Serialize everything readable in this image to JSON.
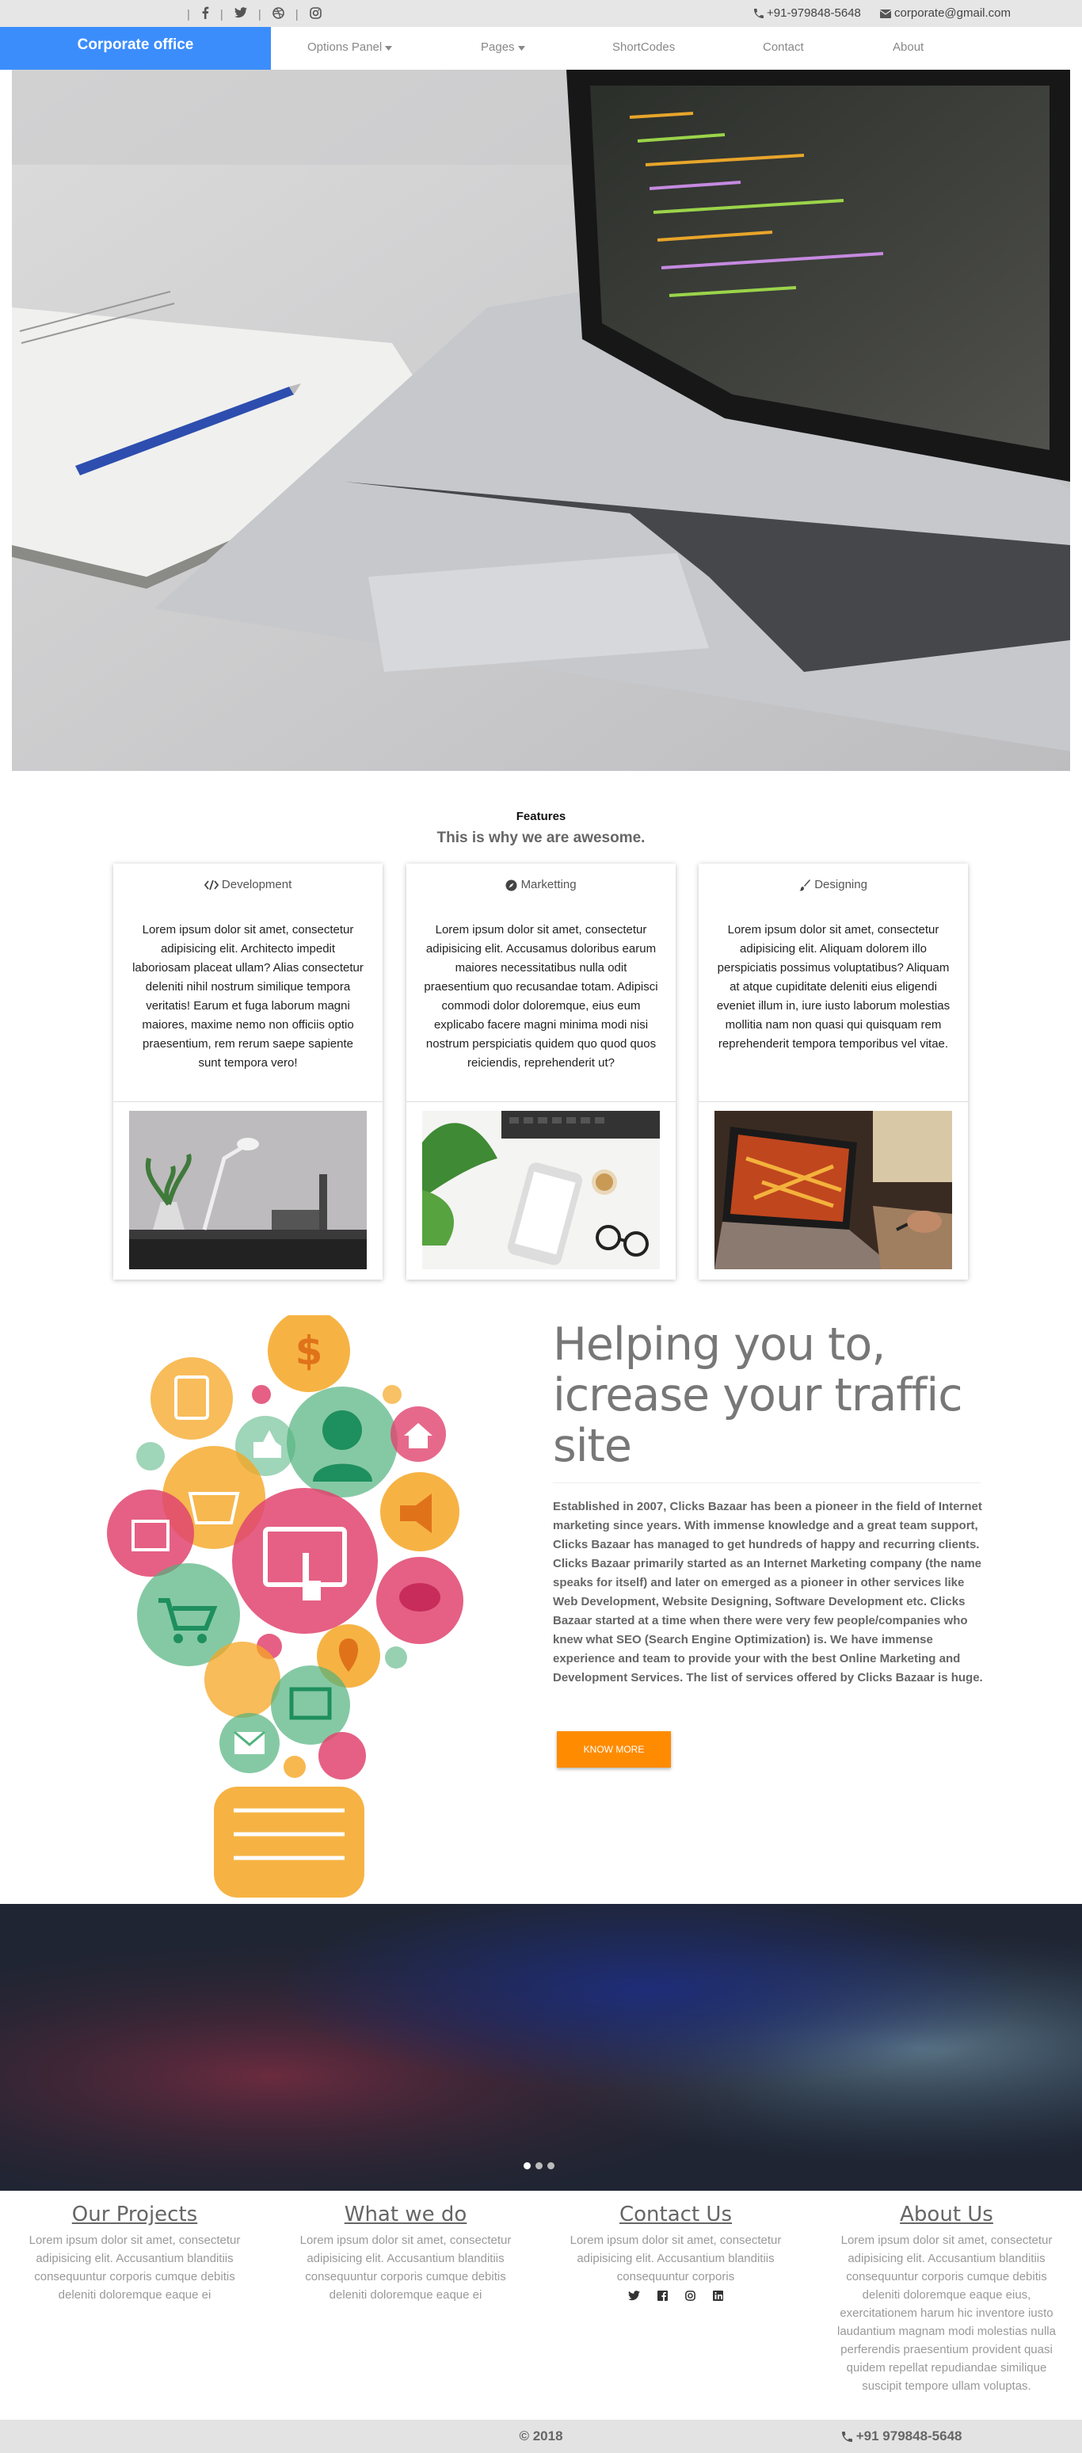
{
  "topbar": {
    "social_icons": [
      "facebook-icon",
      "twitter-icon",
      "dribbble-icon",
      "instagram-icon"
    ],
    "phone": "+91-979848-5648",
    "email": "corporate@gmail.com"
  },
  "nav": {
    "brand": "Corporate office",
    "items": [
      "Options Panel",
      "Pages",
      "ShortCodes",
      "Contact",
      "About"
    ]
  },
  "features": {
    "title": "Features",
    "subtitle": "This is why we are awesome.",
    "cards": [
      {
        "icon": "code-icon",
        "title": "Development",
        "text": "Lorem ipsum dolor sit amet, consectetur adipisicing elit. Architecto impedit laboriosam placeat ullam? Alias consectetur deleniti nihil nostrum similique tempora veritatis! Earum et fuga laborum magni maiores, maxime nemo non officiis optio praesentium, rem rerum saepe sapiente sunt tempora vero!"
      },
      {
        "icon": "compass-icon",
        "title": "Marketting",
        "text": "Lorem ipsum dolor sit amet, consectetur adipisicing elit. Accusamus doloribus earum maiores necessitatibus nulla odit praesentium quo recusandae totam. Adipisci commodi dolor doloremque, eius eum explicabo facere magni minima modi nisi nostrum perspiciatis quidem quo quod quos reiciendis, reprehenderit ut?"
      },
      {
        "icon": "paintbrush-icon",
        "title": "Designing",
        "text": "Lorem ipsum dolor sit amet, consectetur adipisicing elit. Aliquam dolorem illo perspiciatis possimus voluptatibus? Aliquam at atque cupiditate deleniti eius eligendi eveniet illum in, iure iusto laborum molestias mollitia nam non quasi qui quisquam rem reprehenderit tempora temporibus vel vitae."
      }
    ]
  },
  "helping": {
    "heading": "Helping you to, icrease your traffic site",
    "body": "Established in 2007, Clicks Bazaar has been a pioneer in the field of Internet marketing since years. With immense knowledge and a great team support, Clicks Bazaar has managed to get hundreds of happy and recurring clients. Clicks Bazaar primarily started as an Internet Marketing company (the name speaks for itself) and later on emerged as a pioneer in other services like Web Development, Website Designing, Software Development etc. Clicks Bazaar started at a time when there were very few people/companies who knew what SEO (Search Engine Optimization) is. We have immense experience and team to provide your with the best Online Marketing and Development Services. The list of services offered by Clicks Bazaar is huge.",
    "button": "KNOW MORE"
  },
  "footer_cols": [
    {
      "title": "Our Projects",
      "text": "Lorem ipsum dolor sit amet, consectetur adipisicing elit. Accusantium blanditiis consequuntur corporis cumque debitis deleniti doloremque eaque ei"
    },
    {
      "title": "What we do",
      "text": "Lorem ipsum dolor sit amet, consectetur adipisicing elit. Accusantium blanditiis consequuntur corporis cumque debitis deleniti doloremque eaque ei"
    },
    {
      "title": "Contact Us",
      "text": "Lorem ipsum dolor sit amet, consectetur adipisicing elit. Accusantium blanditiis consequuntur corporis"
    },
    {
      "title": "About Us",
      "text": "Lorem ipsum dolor sit amet, consectetur adipisicing elit. Accusantium blanditiis consequuntur corporis cumque debitis deleniti doloremque eaque eius, exercitationem harum hic inventore iusto laudantium magnam modi molestias nulla perferendis praesentium provident quasi quidem repellat repudiandae similique suscipit tempore ullam voluptas."
    }
  ],
  "contact_icons": [
    "twitter-icon",
    "facebook-icon",
    "instagram-icon",
    "linkedin-icon"
  ],
  "footer": {
    "copyright": "© 2018",
    "phone": "+91 979848-5648"
  },
  "colors": {
    "brand": "#3c8dfc",
    "button": "#ff8c00"
  }
}
